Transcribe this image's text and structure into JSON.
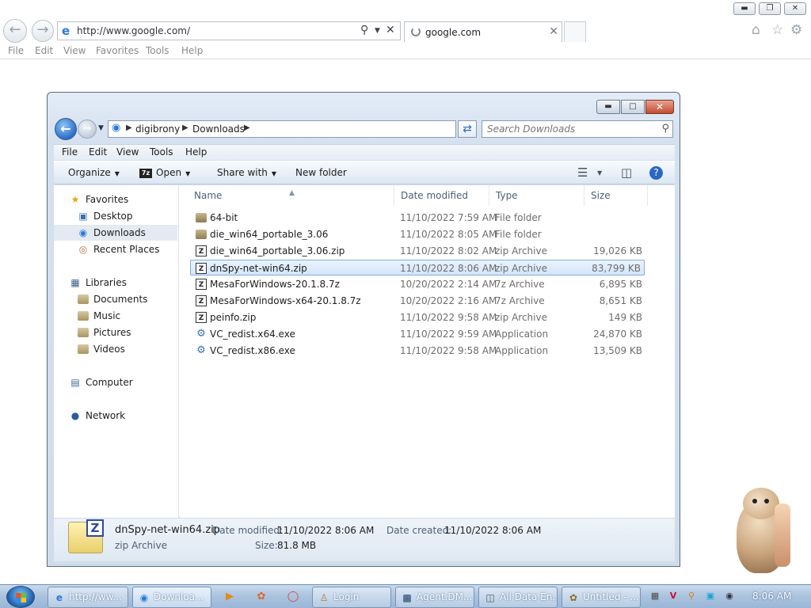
{
  "browser": {
    "url": "http://www.google.com/",
    "tab_title": "google.com",
    "menu": [
      "File",
      "Edit",
      "View",
      "Favorites",
      "Tools",
      "Help"
    ]
  },
  "explorer": {
    "breadcrumb": [
      "digibrony",
      "Downloads"
    ],
    "search_placeholder": "Search Downloads",
    "menu": [
      "File",
      "Edit",
      "View",
      "Tools",
      "Help"
    ],
    "commands": {
      "organize": "Organize",
      "open": "Open",
      "share": "Share with",
      "new_folder": "New folder"
    },
    "nav": {
      "favorites": "Favorites",
      "desktop": "Desktop",
      "downloads": "Downloads",
      "recent": "Recent Places",
      "libraries": "Libraries",
      "documents": "Documents",
      "music": "Music",
      "pictures": "Pictures",
      "videos": "Videos",
      "computer": "Computer",
      "network": "Network"
    },
    "columns": {
      "name": "Name",
      "date": "Date modified",
      "type": "Type",
      "size": "Size"
    },
    "files": [
      {
        "name": "64-bit",
        "date": "11/10/2022 7:59 AM",
        "type": "File folder",
        "size": "",
        "icon": "folder"
      },
      {
        "name": "die_win64_portable_3.06",
        "date": "11/10/2022 8:05 AM",
        "type": "File folder",
        "size": "",
        "icon": "folder"
      },
      {
        "name": "die_win64_portable_3.06.zip",
        "date": "11/10/2022 8:02 AM",
        "type": "zip Archive",
        "size": "19,026 KB",
        "icon": "zip"
      },
      {
        "name": "dnSpy-net-win64.zip",
        "date": "11/10/2022 8:06 AM",
        "type": "zip Archive",
        "size": "83,799 KB",
        "icon": "zip",
        "selected": true
      },
      {
        "name": "MesaForWindows-20.1.8.7z",
        "date": "10/20/2022 2:14 AM",
        "type": "7z Archive",
        "size": "6,895 KB",
        "icon": "zip"
      },
      {
        "name": "MesaForWindows-x64-20.1.8.7z",
        "date": "10/20/2022 2:16 AM",
        "type": "7z Archive",
        "size": "8,651 KB",
        "icon": "zip"
      },
      {
        "name": "peinfo.zip",
        "date": "11/10/2022 9:58 AM",
        "type": "zip Archive",
        "size": "149 KB",
        "icon": "zip"
      },
      {
        "name": "VC_redist.x64.exe",
        "date": "11/10/2022 9:59 AM",
        "type": "Application",
        "size": "24,870 KB",
        "icon": "exe"
      },
      {
        "name": "VC_redist.x86.exe",
        "date": "11/10/2022 9:58 AM",
        "type": "Application",
        "size": "13,509 KB",
        "icon": "exe"
      }
    ],
    "details": {
      "name": "dnSpy-net-win64.zip",
      "type": "zip Archive",
      "modified_label": "Date modified:",
      "modified": "11/10/2022 8:06 AM",
      "created_label": "Date created:",
      "created": "11/10/2022 8:06 AM",
      "size_label": "Size:",
      "size": "81.8 MB"
    }
  },
  "taskbar": {
    "items": [
      "http://ww...",
      "Downloa...",
      "Login",
      "Agent.DM...",
      "All Data En...",
      "Untitled - ..."
    ],
    "clock": "8:06 AM"
  }
}
